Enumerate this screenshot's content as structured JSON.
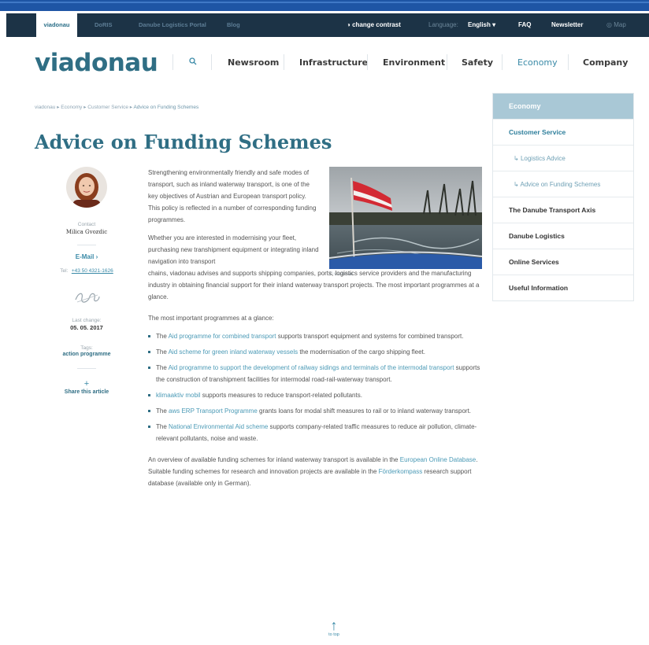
{
  "top_bar": {
    "tabs": [
      "viadonau",
      "DoRIS",
      "Danube Logistics Portal",
      "Blog"
    ],
    "change_contrast": "change contrast",
    "language_label": "Language:",
    "language_value": "English",
    "faq": "FAQ",
    "newsletter": "Newsletter",
    "map": "Map"
  },
  "logo": "viadonau",
  "main_nav": [
    "Newsroom",
    "Infrastructure",
    "Environment",
    "Safety",
    "Economy",
    "Company"
  ],
  "breadcrumb": [
    "viadonau",
    "Economy",
    "Customer Service",
    "Advice on Funding Schemes"
  ],
  "page_title": "Advice on Funding Schemes",
  "contact": {
    "label": "Contact",
    "name": "Milica Gvozdic",
    "email_label": "E-Mail",
    "tel_label": "Tel:",
    "tel_value": "+43 50 4321-1626",
    "last_change_label": "Last change:",
    "last_change_value": "05. 05. 2017",
    "tags_label": "Tags:",
    "tag": "action programme",
    "share_plus": "+",
    "share": "Share this article"
  },
  "article": {
    "intro": "Strengthening environmentally friendly and safe modes of transport, such as inland waterway transport, is one of the key objectives of Austrian and European transport policy. This policy is reflected in a number of corresponding funding programmes.",
    "para2_a": "Whether you are interested in modernising your fleet, purchasing new transhipment equipment or integrating inland navigation into transport",
    "para2_b": "chains, viadonau advises and supports shipping companies, ports, logistics service providers and the manufacturing industry in obtaining financial support for their inland waterway transport projects. The most important programmes at a glance.",
    "list_intro": "The most important programmes at a glance:",
    "bullets": [
      {
        "pre": "The ",
        "link": "Aid programme for combined transport",
        "post": " supports transport equipment and systems for combined transport."
      },
      {
        "pre": "The ",
        "link": "Aid scheme for green inland waterway vessels",
        "post": " the modernisation of the cargo shipping fleet."
      },
      {
        "pre": "The ",
        "link": "Aid programme to support the development of railway sidings and terminals of the intermodal transport",
        "post": " supports the construction of transhipment facilities for intermodal road-rail-waterway transport."
      },
      {
        "pre": "",
        "link": "klimaaktiv mobil",
        "post": " supports measures to reduce transport-related pollutants."
      },
      {
        "pre": "The ",
        "link": "aws ERP Transport Programme",
        "post": " grants loans for modal shift measures to rail or to inland waterway transport."
      },
      {
        "pre": "The ",
        "link": "National Environmental Aid scheme",
        "post": " supports company-related traffic measures to reduce air pollution, climate-relevant pollutants, noise and waste."
      }
    ],
    "closing_a": "An overview of available funding schemes for inland waterway transport is available in the ",
    "closing_link1": "European Online Database",
    "closing_b": ". Suitable funding schemes for research and innovation projects are available in the ",
    "closing_link2": "Förderkompass",
    "closing_c": " research support database (available only in German)."
  },
  "photo_caption": "© viadonau",
  "sidebar": {
    "head": "Economy",
    "customer_service": "Customer Service",
    "sub_items": [
      "Logistics Advice",
      "Advice on Funding Schemes"
    ],
    "items": [
      "The Danube Transport Axis",
      "Danube Logistics",
      "Online Services",
      "Useful Information"
    ]
  },
  "to_top": "to top",
  "colors": {
    "brand": "#2f6e84",
    "topbar": "#1c3346",
    "sidebar_head": "#a9c8d6",
    "link": "#4b9ab6"
  }
}
